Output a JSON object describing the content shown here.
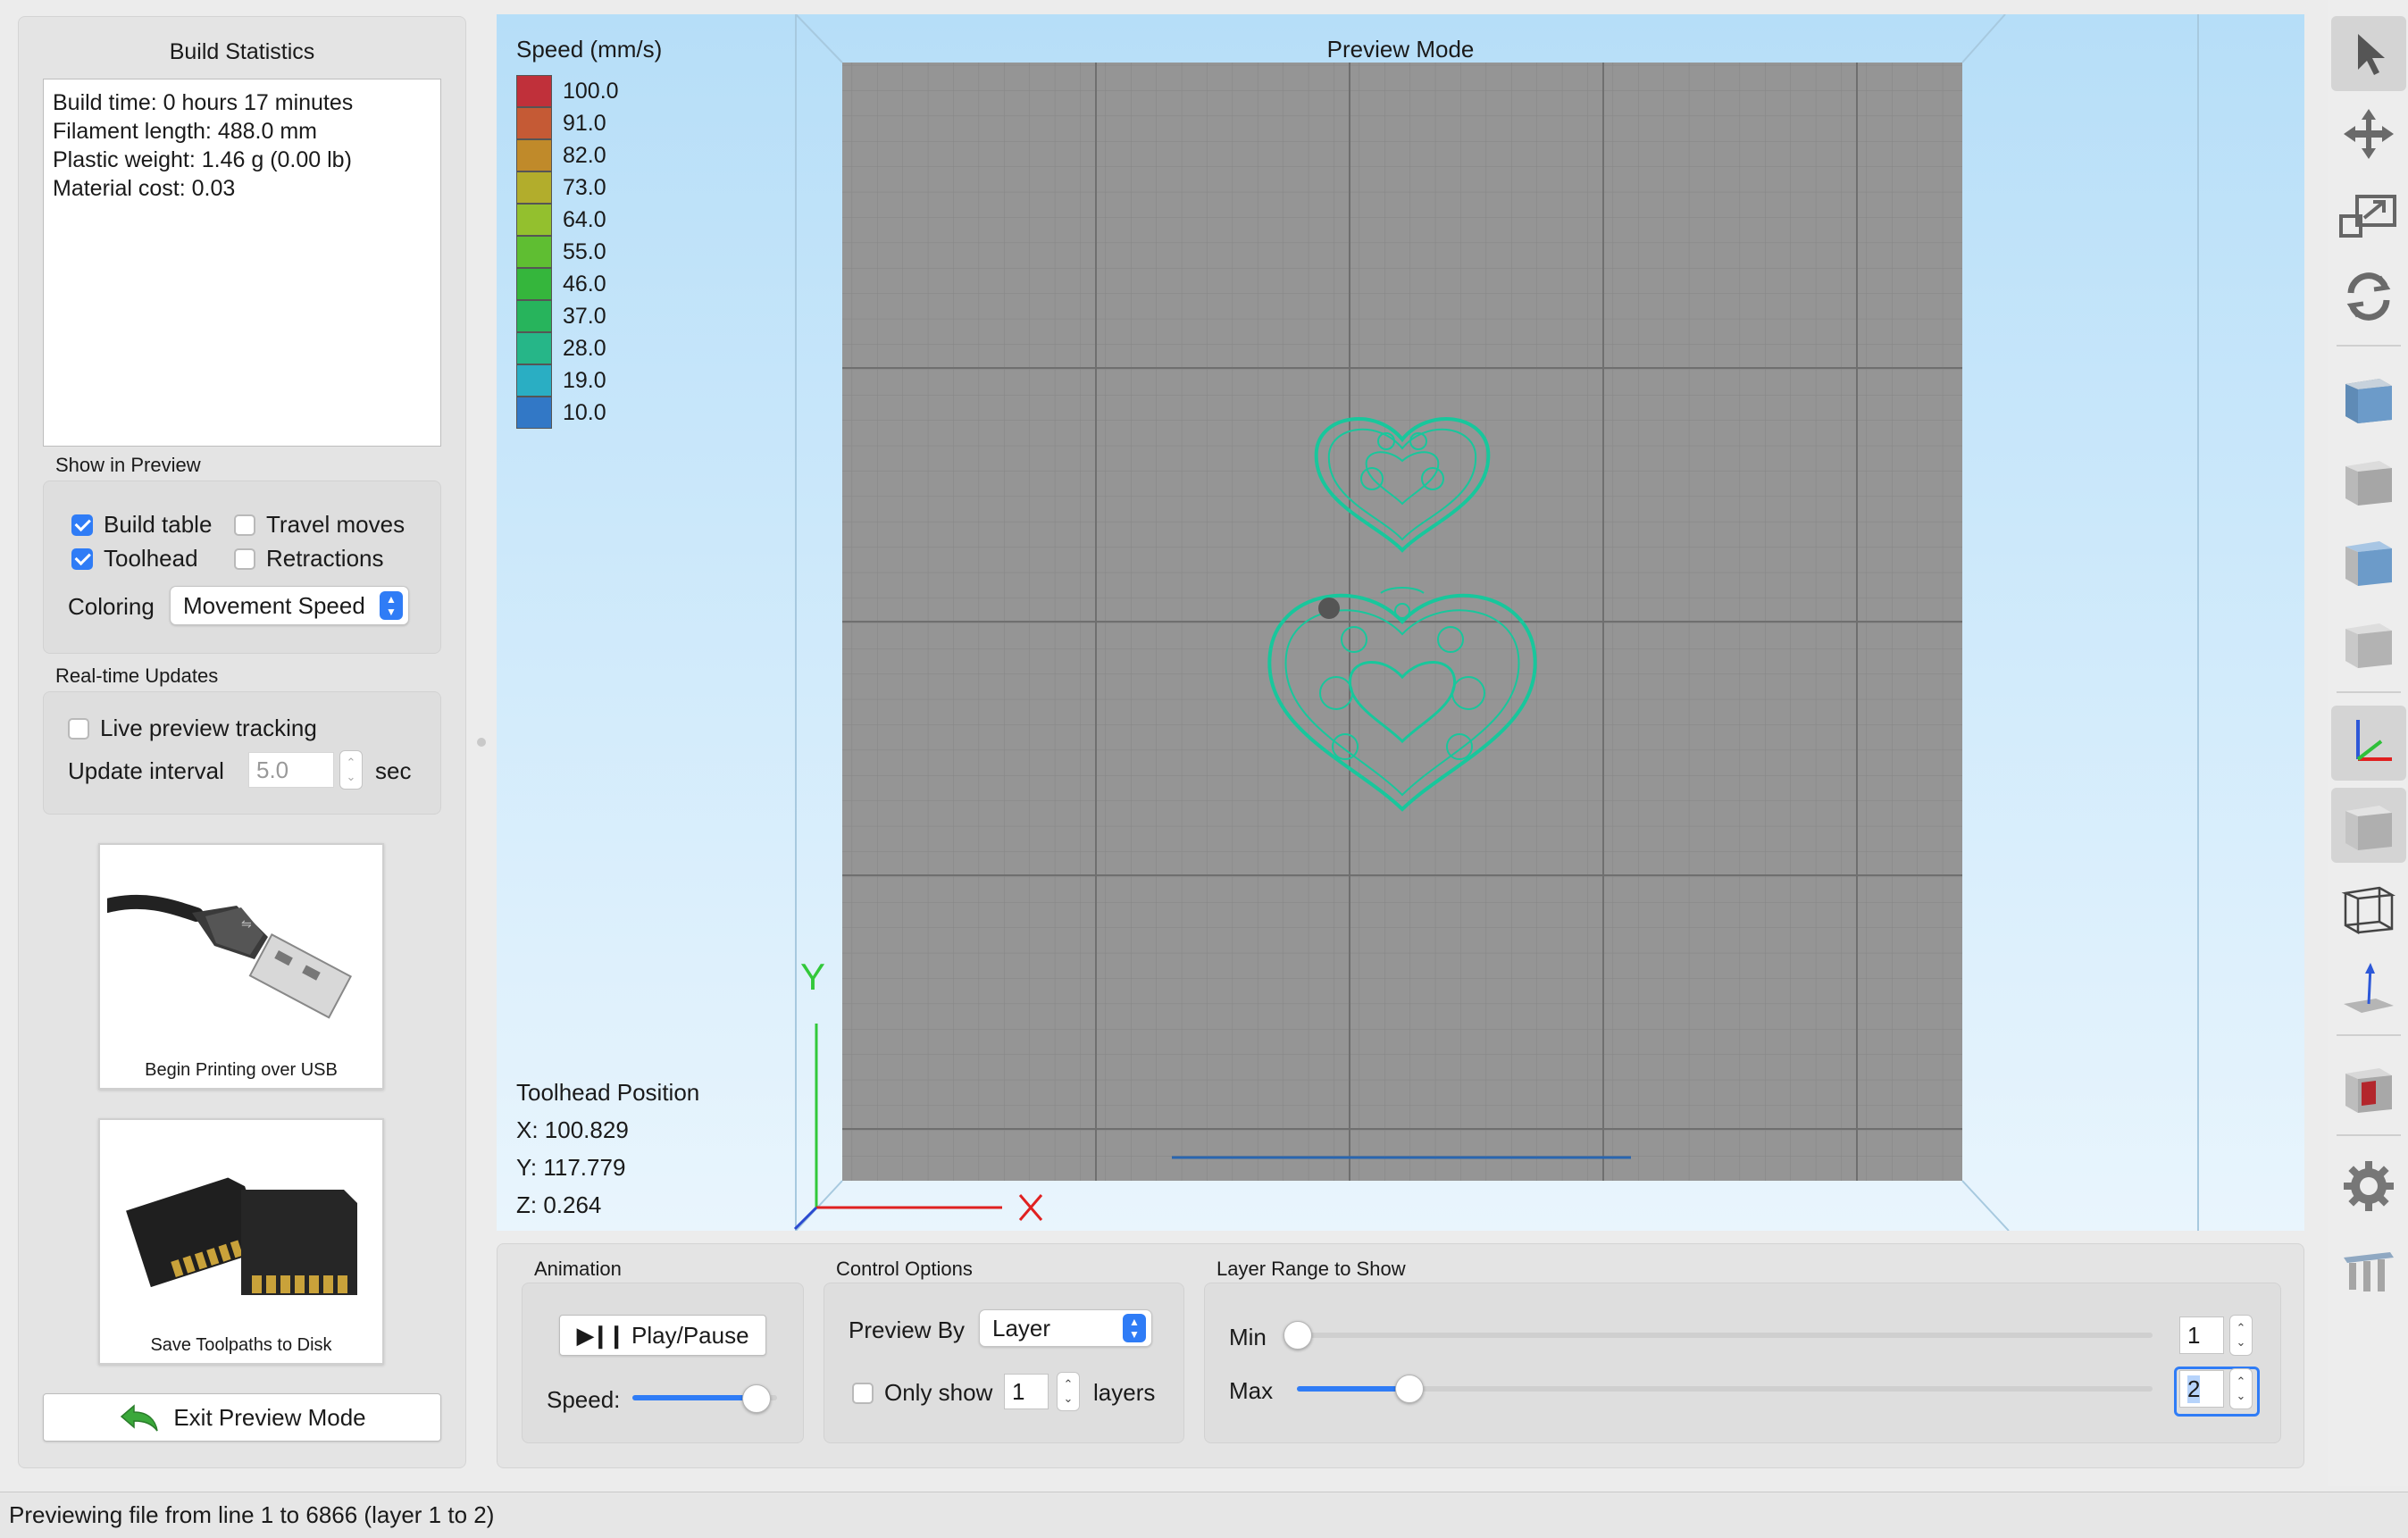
{
  "build_stats": {
    "title": "Build Statistics",
    "lines": [
      "Build time: 0 hours 17 minutes",
      "Filament length: 488.0 mm",
      "Plastic weight: 1.46 g (0.00 lb)",
      "Material cost: 0.03"
    ]
  },
  "show_in_preview": {
    "title": "Show in Preview",
    "build_table": {
      "label": "Build table",
      "checked": true
    },
    "travel_moves": {
      "label": "Travel moves",
      "checked": false
    },
    "toolhead": {
      "label": "Toolhead",
      "checked": true
    },
    "retractions": {
      "label": "Retractions",
      "checked": false
    },
    "coloring_label": "Coloring",
    "coloring_value": "Movement Speed"
  },
  "realtime": {
    "title": "Real-time Updates",
    "live_label": "Live preview tracking",
    "live_checked": false,
    "interval_label": "Update interval",
    "interval_value": "5.0",
    "interval_unit": "sec"
  },
  "actions": {
    "usb_label": "Begin Printing over USB",
    "disk_label": "Save Toolpaths to Disk",
    "exit_label": "Exit Preview Mode"
  },
  "viewport": {
    "mode_title": "Preview Mode",
    "legend_title": "Speed (mm/s)",
    "legend": [
      {
        "label": "100.0",
        "color": "#c0303a"
      },
      {
        "label": "91.0",
        "color": "#c55a35"
      },
      {
        "label": "82.0",
        "color": "#c08a2a"
      },
      {
        "label": "73.0",
        "color": "#b2ad2c"
      },
      {
        "label": "64.0",
        "color": "#93c02e"
      },
      {
        "label": "55.0",
        "color": "#5fbe32"
      },
      {
        "label": "46.0",
        "color": "#35b63c"
      },
      {
        "label": "37.0",
        "color": "#27b45c"
      },
      {
        "label": "28.0",
        "color": "#26b688"
      },
      {
        "label": "19.0",
        "color": "#2aaec3"
      },
      {
        "label": "10.0",
        "color": "#3278c6"
      }
    ],
    "axis_y": "Y",
    "toolhead_title": "Toolhead Position",
    "toolhead_x": "X: 100.829",
    "toolhead_y": "Y: 117.779",
    "toolhead_z": "Z: 0.264",
    "toolpath_color": "#18c79c"
  },
  "animation": {
    "title": "Animation",
    "play_label": "Play/Pause",
    "speed_label": "Speed:",
    "speed_fraction": 0.85
  },
  "control": {
    "title": "Control Options",
    "preview_by_label": "Preview By",
    "preview_by_value": "Layer",
    "only_show_label": "Only show",
    "only_show_checked": false,
    "only_show_value": "1",
    "layers_label": "layers"
  },
  "layer_range": {
    "title": "Layer Range to Show",
    "min_label": "Min",
    "min_value": "1",
    "min_fraction": 0.0,
    "max_label": "Max",
    "max_value": "2",
    "max_fraction": 0.13
  },
  "toolbar": {
    "tools": [
      "select-arrow-icon",
      "move-icon",
      "scale-icon",
      "rotate-icon",
      "view-front-icon",
      "view-side-icon",
      "view-top-icon",
      "view-iso-icon",
      "axes-icon",
      "solid-view-icon",
      "wireframe-view-icon",
      "layflat-icon",
      "cross-section-icon",
      "settings-gear-icon",
      "supports-icon"
    ]
  },
  "status": {
    "text": "Previewing file from line 1 to 6866 (layer 1 to 2)"
  },
  "accent_color": "#2f7cf6"
}
